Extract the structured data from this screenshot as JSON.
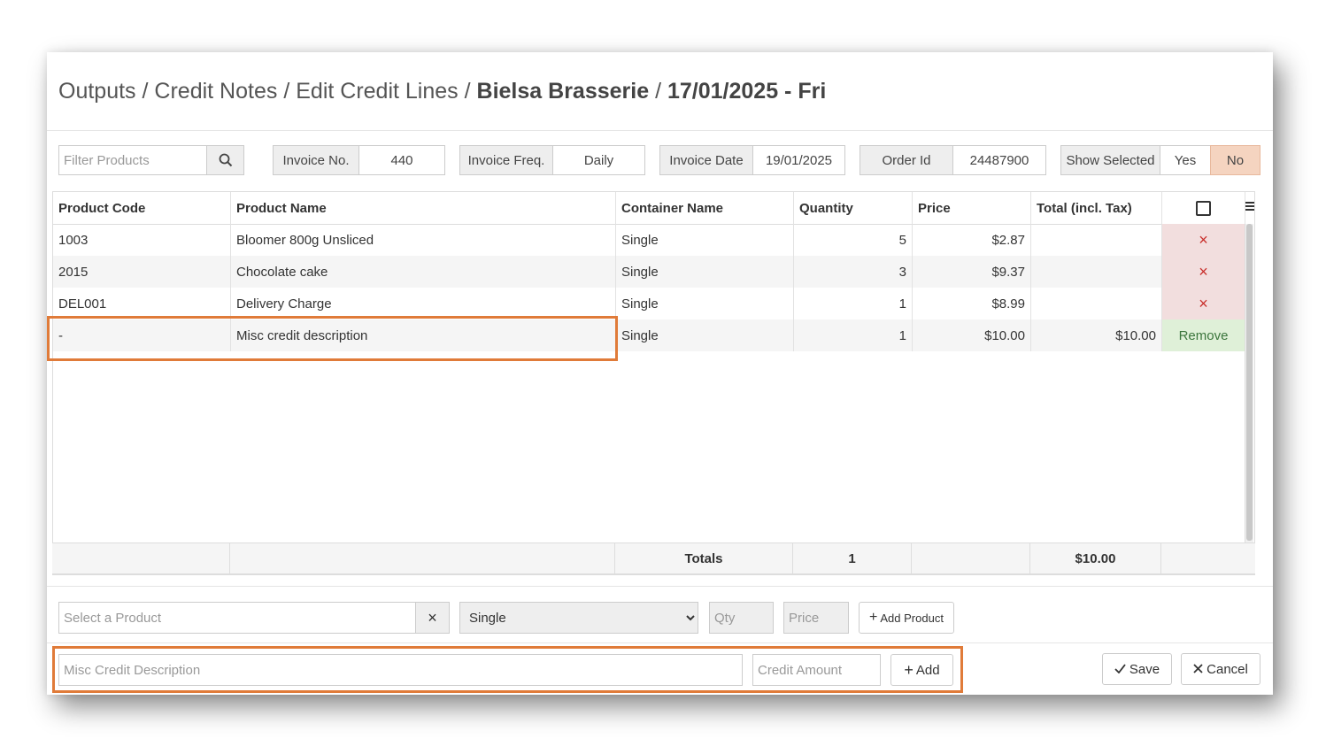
{
  "breadcrumb": {
    "part1": "Outputs",
    "part2": "Credit Notes",
    "part3": "Edit Credit Lines",
    "customer": "Bielsa Brasserie",
    "date": "17/01/2025 - Fri",
    "sep": "/"
  },
  "toolbar": {
    "filter_placeholder": "Filter Products",
    "invoice_no_label": "Invoice No.",
    "invoice_no_value": "440",
    "invoice_freq_label": "Invoice Freq.",
    "invoice_freq_value": "Daily",
    "invoice_date_label": "Invoice Date",
    "invoice_date_value": "19/01/2025",
    "order_id_label": "Order Id",
    "order_id_value": "24487900",
    "show_selected_label": "Show Selected",
    "yes_label": "Yes",
    "no_label": "No"
  },
  "table": {
    "headers": {
      "code": "Product Code",
      "name": "Product Name",
      "container": "Container Name",
      "qty": "Quantity",
      "price": "Price",
      "total": "Total (incl. Tax)"
    },
    "rows": [
      {
        "code": "1003",
        "name": "Bloomer 800g Unsliced",
        "container": "Single",
        "qty": "5",
        "price": "$2.87",
        "total": "",
        "action": "×"
      },
      {
        "code": "2015",
        "name": "Chocolate cake",
        "container": "Single",
        "qty": "3",
        "price": "$9.37",
        "total": "",
        "action": "×"
      },
      {
        "code": "DEL001",
        "name": "Delivery Charge",
        "container": "Single",
        "qty": "1",
        "price": "$8.99",
        "total": "",
        "action": "×"
      },
      {
        "code": "-",
        "name": "Misc credit description",
        "container": "Single",
        "qty": "1",
        "price": "$10.00",
        "total": "$10.00",
        "action": "Remove"
      }
    ],
    "totals": {
      "label": "Totals",
      "qty": "1",
      "total": "$10.00"
    }
  },
  "add_product": {
    "select_placeholder": "Select a Product",
    "clear": "×",
    "container_selected": "Single",
    "qty_placeholder": "Qty",
    "price_placeholder": "Price",
    "add_label": "Add Product"
  },
  "misc_credit": {
    "description_placeholder": "Misc Credit Description",
    "amount_placeholder": "Credit Amount",
    "add_label": "Add"
  },
  "actions": {
    "save_label": "Save",
    "cancel_label": "Cancel"
  },
  "colors": {
    "highlight": "#e07b39",
    "no_active": "#f5d4c0",
    "remove_bg": "#dff0d8",
    "delete_bg": "#f2dede"
  }
}
